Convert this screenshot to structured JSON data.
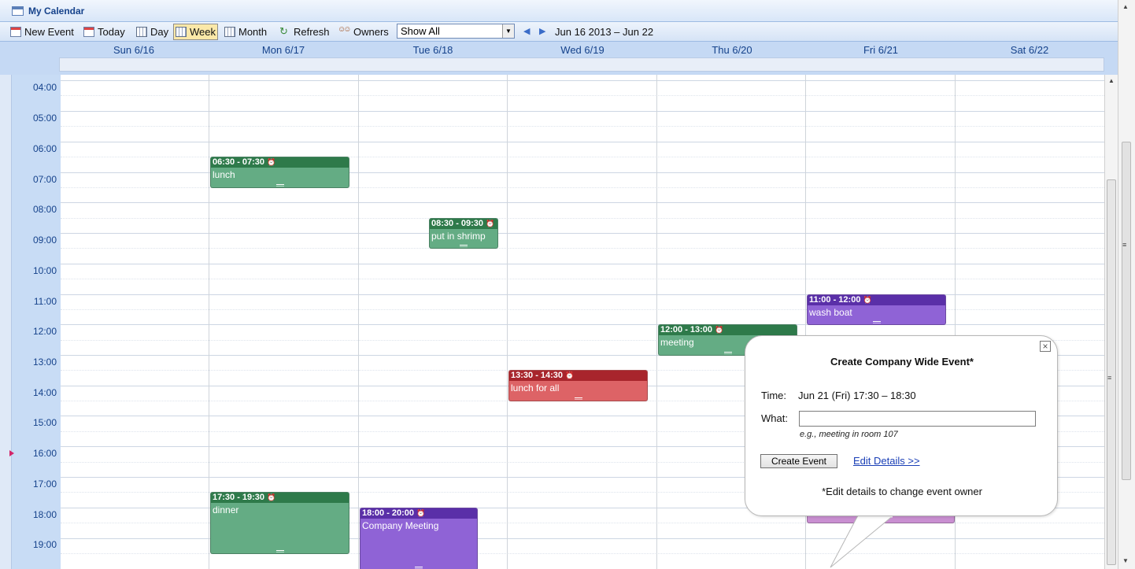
{
  "window": {
    "title": "My Calendar"
  },
  "toolbar": {
    "new_event": "New Event",
    "today": "Today",
    "day": "Day",
    "week": "Week",
    "month": "Month",
    "refresh": "Refresh",
    "owners": "Owners",
    "filter_value": "Show All",
    "date_range": "Jun 16 2013 – Jun 22",
    "active_view": "Week"
  },
  "days": [
    "Sun 6/16",
    "Mon 6/17",
    "Tue 6/18",
    "Wed 6/19",
    "Thu 6/20",
    "Fri 6/21",
    "Sat 6/22"
  ],
  "times": [
    "04:00",
    "05:00",
    "06:00",
    "07:00",
    "08:00",
    "09:00",
    "10:00",
    "11:00",
    "12:00",
    "13:00",
    "14:00",
    "15:00",
    "16:00",
    "17:00",
    "18:00",
    "19:00"
  ],
  "events": [
    {
      "day": "Mon 6/17",
      "time": "06:30 - 07:30",
      "title": "lunch",
      "color": "green"
    },
    {
      "day": "Tue 6/18",
      "time": "08:30 - 09:30",
      "title": "put in shrimp",
      "color": "green"
    },
    {
      "day": "Fri 6/21",
      "time": "11:00 - 12:00",
      "title": "wash boat",
      "color": "purple"
    },
    {
      "day": "Thu 6/20",
      "time": "12:00 - 13:00",
      "title": "meeting",
      "color": "green"
    },
    {
      "day": "Wed 6/19",
      "time": "13:30 - 14:30",
      "title": "lunch for all",
      "color": "red"
    },
    {
      "day": "Mon 6/17",
      "time": "17:30 - 19:30",
      "title": "dinner",
      "color": "green"
    },
    {
      "day": "Tue 6/18",
      "time": "18:00 - 20:00",
      "title": "Company Meeting",
      "color": "purple"
    }
  ],
  "colors": {
    "green_head": "#2e7a4a",
    "green_body": "#64ac84",
    "purple_head": "#5a2fa8",
    "purple_body": "#8f63d6",
    "red_head": "#a8252c",
    "red_body": "#dd6366",
    "pink_body": "#c98fd1"
  },
  "popup": {
    "title": "Create Company Wide Event*",
    "time_label": "Time:",
    "time_value": "Jun 21 (Fri) 17:30 – 18:30",
    "what_label": "What:",
    "what_value": "",
    "hint": "e.g., meeting in room 107",
    "create_button": "Create Event",
    "edit_link": "Edit Details >>",
    "note": "*Edit details to change event owner"
  }
}
